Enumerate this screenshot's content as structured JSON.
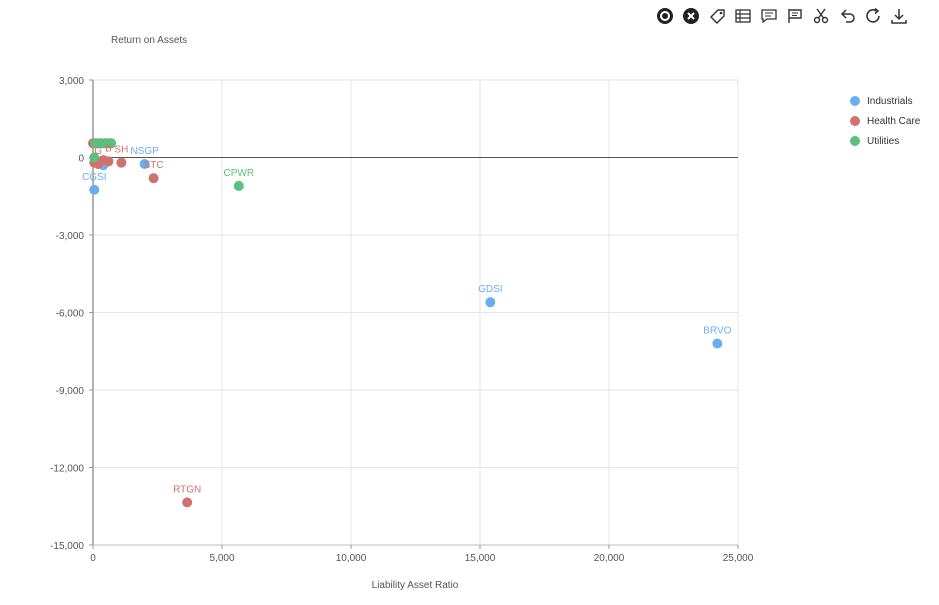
{
  "toolbar": {
    "icons": [
      "target-icon",
      "close-circle-icon",
      "tag-icon",
      "list-icon",
      "comment-icon",
      "flag-icon",
      "scissors-icon",
      "undo-icon",
      "refresh-icon",
      "download-icon"
    ]
  },
  "chart_data": {
    "type": "scatter",
    "ylabel": "Return on Assets",
    "xlabel": "Liability Asset Ratio",
    "xlim": [
      0,
      25000
    ],
    "ylim": [
      -15000,
      3000
    ],
    "x_ticks": [
      "0",
      "5,000",
      "10,000",
      "15,000",
      "20,000",
      "25,000"
    ],
    "y_ticks": [
      "3,000",
      "0",
      "-3,000",
      "-6,000",
      "-9,000",
      "-12,000",
      "-15,000"
    ],
    "grid": true,
    "legend_position": "right",
    "series": [
      {
        "name": "Industrials",
        "color": "#6aaef0",
        "points": [
          {
            "x": 24200,
            "y": -7200,
            "label": "BRVO"
          },
          {
            "x": 15400,
            "y": -5600,
            "label": "GDSI"
          },
          {
            "x": 2000,
            "y": -250,
            "label": "NSGP"
          },
          {
            "x": 50,
            "y": -1250,
            "label": "CGSI"
          },
          {
            "x": 400,
            "y": -300,
            "label": ""
          },
          {
            "x": 150,
            "y": 550,
            "label": ""
          },
          {
            "x": 300,
            "y": 550,
            "label": ""
          },
          {
            "x": 100,
            "y": -100,
            "label": ""
          }
        ]
      },
      {
        "name": "Health Care",
        "color": "#d0716f",
        "points": [
          {
            "x": 3650,
            "y": -13350,
            "label": "RTGN"
          },
          {
            "x": 2350,
            "y": -800,
            "label": "STC"
          },
          {
            "x": 1100,
            "y": -200,
            "label": "SH"
          },
          {
            "x": 600,
            "y": -150,
            "label": "B"
          },
          {
            "x": 400,
            "y": -100,
            "label": ""
          },
          {
            "x": 200,
            "y": -250,
            "label": "G"
          },
          {
            "x": 50,
            "y": -200,
            "label": ""
          },
          {
            "x": 300,
            "y": 550,
            "label": ""
          },
          {
            "x": 100,
            "y": 550,
            "label": ""
          },
          {
            "x": 500,
            "y": 550,
            "label": ""
          },
          {
            "x": 700,
            "y": 550,
            "label": ""
          },
          {
            "x": 0,
            "y": 550,
            "label": ""
          }
        ]
      },
      {
        "name": "Utilities",
        "color": "#5cbf7e",
        "points": [
          {
            "x": 5650,
            "y": -1100,
            "label": "CPWR"
          },
          {
            "x": 50,
            "y": 0,
            "label": ""
          },
          {
            "x": 100,
            "y": 550,
            "label": ""
          },
          {
            "x": 250,
            "y": 550,
            "label": ""
          },
          {
            "x": 450,
            "y": 550,
            "label": ""
          },
          {
            "x": 600,
            "y": 550,
            "label": ""
          },
          {
            "x": 700,
            "y": 550,
            "label": ""
          }
        ]
      }
    ]
  }
}
